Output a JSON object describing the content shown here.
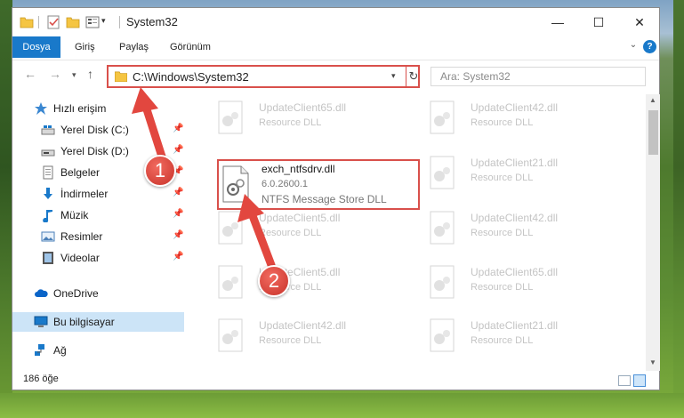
{
  "window": {
    "title": "System32"
  },
  "ribbon": {
    "tabs": [
      "Dosya",
      "Giriş",
      "Paylaş",
      "Görünüm"
    ]
  },
  "navigation": {
    "address": "C:\\Windows\\System32",
    "search_placeholder": "Ara: System32"
  },
  "sidebar": {
    "items": [
      {
        "label": "Hızlı erişim",
        "icon": "star-icon"
      },
      {
        "label": "Yerel Disk (C:)",
        "icon": "drive-icon",
        "pinned": true
      },
      {
        "label": "Yerel Disk (D:)",
        "icon": "drive-icon",
        "pinned": true
      },
      {
        "label": "Belgeler",
        "icon": "documents-icon",
        "pinned": true
      },
      {
        "label": "İndirmeler",
        "icon": "download-icon",
        "pinned": true
      },
      {
        "label": "Müzik",
        "icon": "music-icon",
        "pinned": true
      },
      {
        "label": "Resimler",
        "icon": "pictures-icon",
        "pinned": true
      },
      {
        "label": "Videolar",
        "icon": "videos-icon",
        "pinned": true
      },
      {
        "label": "OneDrive",
        "icon": "cloud-icon"
      },
      {
        "label": "Bu bilgisayar",
        "icon": "computer-icon",
        "selected": true
      },
      {
        "label": "Ağ",
        "icon": "network-icon"
      }
    ]
  },
  "files": {
    "left": [
      {
        "name": "UpdateClient65.dll",
        "type": "Resource DLL"
      },
      {
        "name": "UpdateClient5.dll",
        "type": "Resource DLL"
      },
      {
        "name": "UpdateClient5.dll",
        "type": "Resource DLL"
      },
      {
        "name": "UpdateClient42.dll",
        "type": "Resource DLL"
      }
    ],
    "right": [
      {
        "name": "UpdateClient42.dll",
        "type": "Resource DLL"
      },
      {
        "name": "UpdateClient21.dll",
        "type": "Resource DLL"
      },
      {
        "name": "UpdateClient42.dll",
        "type": "Resource DLL"
      },
      {
        "name": "UpdateClient65.dll",
        "type": "Resource DLL"
      },
      {
        "name": "UpdateClient21.dll",
        "type": "Resource DLL"
      }
    ],
    "focused": {
      "name": "exch_ntfsdrv.dll",
      "version": "6.0.2600.1",
      "type": "NTFS Message Store DLL"
    }
  },
  "status": {
    "count": "186 öğe"
  },
  "annotations": {
    "marker_1": "1",
    "marker_2": "2"
  },
  "colors": {
    "accent": "#1979ca",
    "highlight": "#d9504b",
    "selection": "#cce4f7"
  }
}
